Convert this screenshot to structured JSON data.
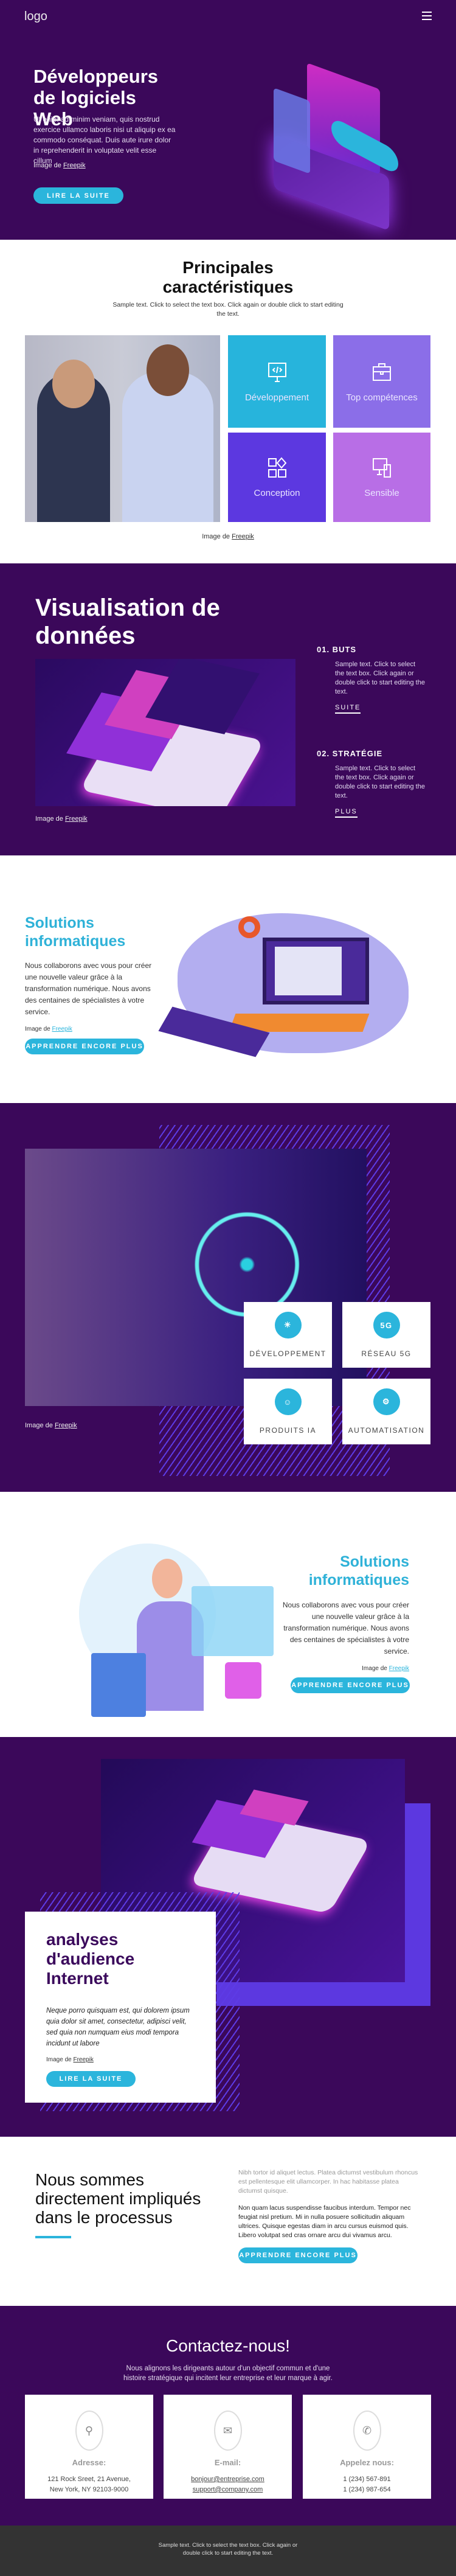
{
  "colors": {
    "purple": "#3b085a",
    "accent": "#2bb5dc",
    "tile_dev": "#27b4dc",
    "tile_top": "#8b6ee8",
    "tile_conc": "#5c38e0",
    "tile_sens": "#b86ee6",
    "footer": "#333333"
  },
  "header": {
    "logo": "logo",
    "menu_icon": "hamburger-icon"
  },
  "hero": {
    "title": "Développeurs de logiciels Web",
    "text": "Ut enim ad minim veniam, quis nostrud exercice ullamco laboris nisi ut aliquip ex ea commodo conséquat. Duis aute irure dolor in reprehenderit in voluptate velit esse cillum",
    "credit_prefix": "Image de",
    "credit_link": "Freepik",
    "button": "LIRE LA SUITE"
  },
  "features": {
    "title": "Principales caractéristiques",
    "text": "Sample text. Click to select the text box. Click again or double click to start editing the text.",
    "tiles": [
      {
        "label": "Développement",
        "icon": "code-monitor-icon"
      },
      {
        "label": "Top compétences",
        "icon": "briefcase-icon"
      },
      {
        "label": "Conception",
        "icon": "shapes-icon"
      },
      {
        "label": "Sensible",
        "icon": "devices-icon"
      }
    ],
    "credit_prefix": "Image de",
    "credit_link": "Freepik"
  },
  "dataviz": {
    "title": "Visualisation de données",
    "items": [
      {
        "heading": "01. BUTS",
        "text": "Sample text. Click to select the text box. Click again or double click to start editing the text.",
        "link": "SUITE"
      },
      {
        "heading": "02. STRATÉGIE",
        "text": "Sample text. Click to select the text box. Click again or double click to start editing the text.",
        "link": "PLUS"
      }
    ],
    "credit_prefix": "Image de",
    "credit_link": "Freepik"
  },
  "solutions1": {
    "title": "Solutions informatiques",
    "text": "Nous collaborons avec vous pour créer une nouvelle valeur grâce à la transformation numérique. Nous avons des centaines de spécialistes à votre service.",
    "credit_prefix": "Image de",
    "credit_link": "Freepik",
    "button": "APPRENDRE ENCORE PLUS"
  },
  "tech": {
    "cards": [
      {
        "label": "DÉVELOPPEMENT",
        "icon": "lightbulb-hand-icon"
      },
      {
        "label": "RÉSEAU 5G",
        "icon": "5g-icon"
      },
      {
        "label": "PRODUITS IA",
        "icon": "ai-head-icon"
      },
      {
        "label": "AUTOMATISATION",
        "icon": "chip-brain-icon"
      }
    ],
    "icon_5g": "5G",
    "credit_prefix": "Image de",
    "credit_link": "Freepik"
  },
  "solutions2": {
    "title": "Solutions informatiques",
    "text": "Nous collaborons avec vous pour créer une nouvelle valeur grâce à la transformation numérique. Nous avons des centaines de spécialistes à votre service.",
    "credit_prefix": "Image de",
    "credit_link": "Freepik",
    "button": "APPRENDRE ENCORE PLUS"
  },
  "analyses": {
    "title": "analyses d'audience Internet",
    "text": "Neque porro quisquam est, qui dolorem ipsum quia dolor sit amet, consectetur, adipisci velit, sed quia non numquam eius modi tempora incidunt ut labore",
    "credit_prefix": "Image de",
    "credit_link": "Freepik",
    "button": "LIRE LA SUITE"
  },
  "process": {
    "title": "Nous sommes directement impliqués dans le processus",
    "text_muted": "Nibh tortor id aliquet lectus. Platea dictumst vestibulum rhoncus est pellentesque elit ullamcorper. In hac habitasse platea dictumst quisque.",
    "text": "Non quam lacus suspendisse faucibus interdum. Tempor nec feugiat nisl pretium. Mi in nulla posuere sollicitudin aliquam ultrices. Quisque egestas diam in arcu cursus euismod quis. Libero volutpat sed cras ornare arcu dui vivamus arcu.",
    "button": "APPRENDRE ENCORE PLUS"
  },
  "contact": {
    "title": "Contactez-nous!",
    "text": "Nous alignons les dirigeants autour d'un objectif commun et d'une histoire stratégique qui incitent leur entreprise et leur marque à agir.",
    "cards": [
      {
        "heading": "Adresse:",
        "line1": "121 Rock Sreet, 21 Avenue,",
        "line2": "New York, NY 92103-9000",
        "icon": "map-pin-icon"
      },
      {
        "heading": "E-mail:",
        "line1": "bonjour@entreprise.com",
        "line2": "support@company.com",
        "icon": "envelope-icon"
      },
      {
        "heading": "Appelez nous:",
        "line1": "1 (234) 567-891",
        "line2": "1 (234) 987-654",
        "icon": "phone-icon"
      }
    ]
  },
  "footer": {
    "text": "Sample text. Click to select the text box. Click again or double click to start editing the text."
  }
}
